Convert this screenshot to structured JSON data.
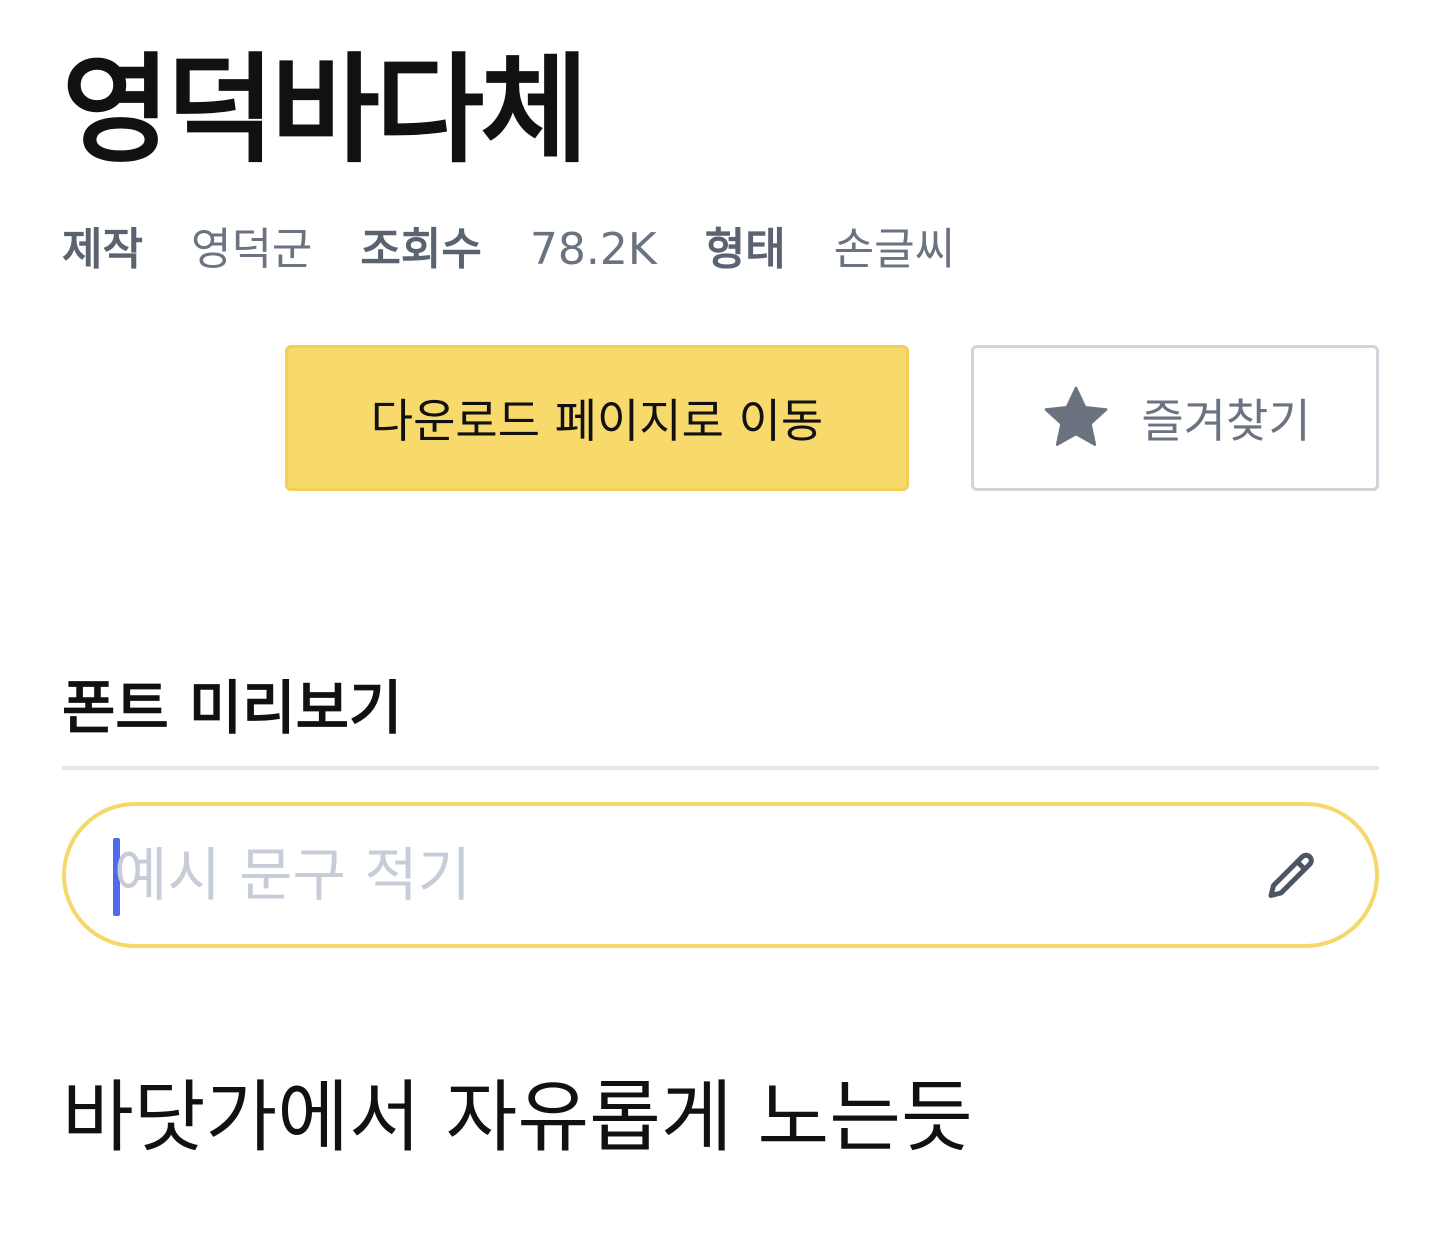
{
  "font": {
    "name": "영덕바다체"
  },
  "meta": {
    "maker_label": "제작",
    "maker_value": "영덕군",
    "views_label": "조회수",
    "views_value": "78.2K",
    "type_label": "형태",
    "type_value": "손글씨"
  },
  "actions": {
    "download_label": "다운로드 페이지로 이동",
    "favorite_label": "즐겨찾기",
    "favorite_icon": "star-icon"
  },
  "preview": {
    "heading": "폰트 미리보기",
    "placeholder": "예시 문구 적기",
    "value": "",
    "edit_icon": "pencil-icon",
    "sample_text": "바닷가에서 자유롭게 노는듯"
  },
  "colors": {
    "accent_yellow": "#f8d96c",
    "caret_blue": "#4f6bed",
    "muted_gray": "#6b7280"
  }
}
